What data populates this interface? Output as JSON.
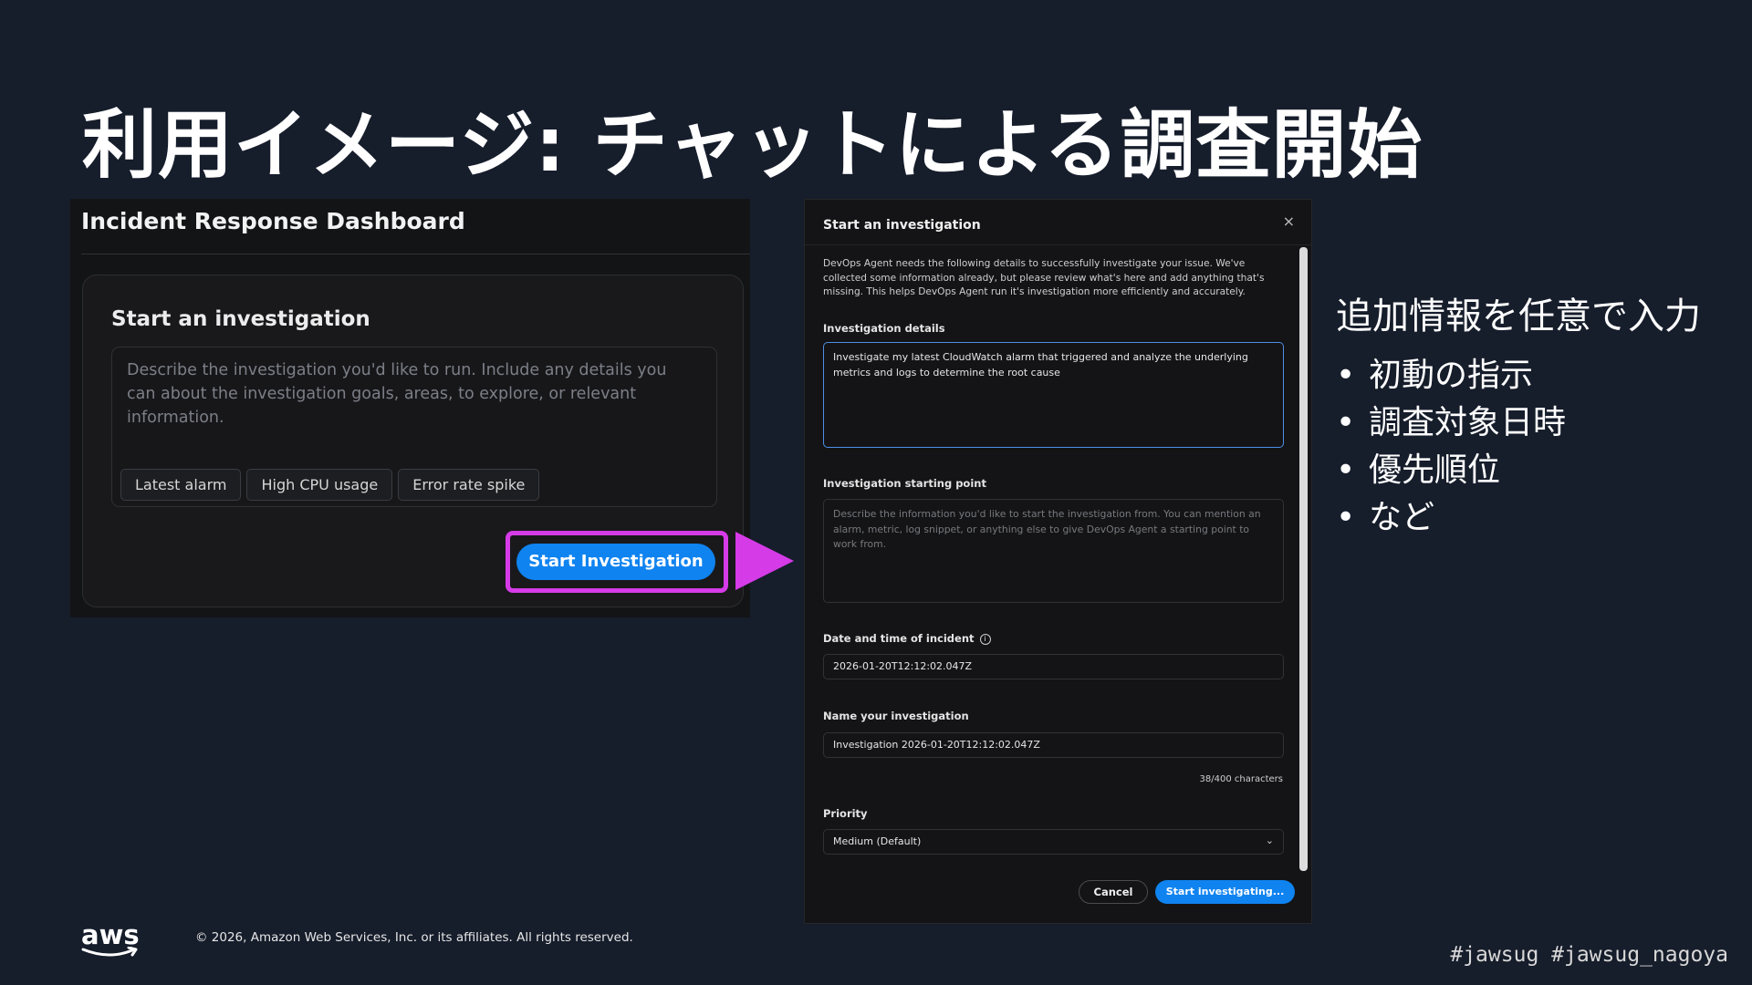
{
  "slide": {
    "title": "利用イメージ: チャットによる調査開始"
  },
  "left_screenshot": {
    "dashboard_title": "Incident Response Dashboard",
    "card_title": "Start an investigation",
    "textarea_placeholder": "Describe the investigation you'd like to run. Include any details you can about the investigation goals, areas, to explore, or relevant information.",
    "chips": [
      "Latest alarm",
      "High CPU usage",
      "Error rate spike"
    ],
    "start_button": "Start Investigation",
    "highlight_color": "#d63be8",
    "accent_color": "#0f83f0"
  },
  "modal": {
    "title": "Start an investigation",
    "close_icon": "×",
    "description": "DevOps Agent needs the following details to successfully investigate your issue. We've collected some information already, but please review what's here and add anything that's missing. This helps DevOps Agent run it's investigation more efficiently and accurately.",
    "details_label": "Investigation details",
    "details_value": "Investigate my latest CloudWatch alarm that triggered and analyze the underlying metrics and logs to determine the root cause",
    "starting_point_label": "Investigation starting point",
    "starting_point_placeholder": "Describe the information you'd like to start the investigation from. You can mention an alarm, metric, log snippet, or anything else to give DevOps Agent a starting point to work from.",
    "date_label": "Date and time of incident",
    "info_icon": "i",
    "date_value": "2026-01-20T12:12:02.047Z",
    "name_label": "Name your investigation",
    "name_value": "Investigation 2026-01-20T12:12:02.047Z",
    "char_count": "38/400 characters",
    "priority_label": "Priority",
    "priority_value": "Medium (Default)",
    "chevron_icon": "⌄",
    "cancel_button": "Cancel",
    "submit_button": "Start investigating..."
  },
  "notes": {
    "heading": "追加情報を任意で入力",
    "bullet": "•",
    "items": [
      "初動の指示",
      "調査対象日時",
      "優先順位",
      "など"
    ]
  },
  "footer": {
    "logo_text": "aws",
    "copyright": "© 2026, Amazon Web Services, Inc. or its affiliates. All rights reserved.",
    "hashtags": "#jawsug #jawsug_nagoya"
  }
}
